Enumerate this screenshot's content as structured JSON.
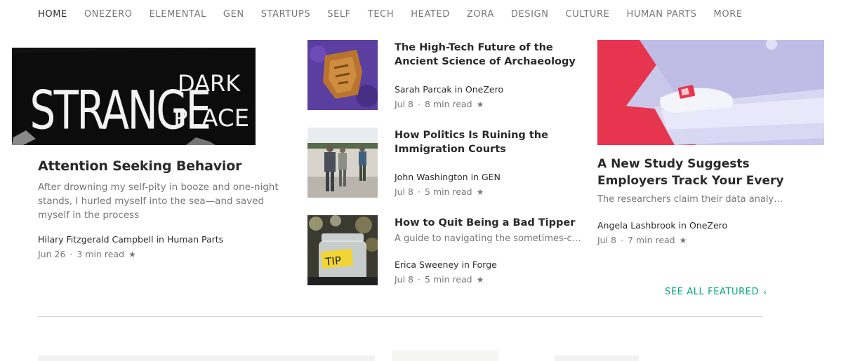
{
  "nav": {
    "items": [
      "HOME",
      "ONEZERO",
      "ELEMENTAL",
      "GEN",
      "STARTUPS",
      "SELF",
      "TECH",
      "HEATED",
      "ZORA",
      "DESIGN",
      "CULTURE",
      "HUMAN PARTS",
      "MORE"
    ],
    "active": "HOME"
  },
  "hero": {
    "image_text": [
      "STRANGE",
      "DARK",
      "PLACE"
    ],
    "title": "Attention Seeking Behavior",
    "subtitle": "After drowning my self-pity in booze and one-night stands, I hurled myself into the sea—and saved myself in the process",
    "byline": "Hilary Fitzgerald Campbell in Human Parts",
    "date": "Jun 26",
    "read_time": "3 min read"
  },
  "middle": [
    {
      "title": "The High-Tech Future of the Ancient Science of Archaeology",
      "subtitle": "",
      "byline": "Sarah Parcak in OneZero",
      "date": "Jul 8",
      "read_time": "8 min read"
    },
    {
      "title": "How Politics Is Ruining the Immigration Courts",
      "subtitle": "",
      "byline": "John Washington in GEN",
      "date": "Jul 8",
      "read_time": "5 min read"
    },
    {
      "title": "How to Quit Being a Bad Tipper",
      "subtitle": "A guide to navigating the sometimes-co…",
      "byline": "Erica Sweeney in Forge",
      "date": "Jul 8",
      "read_time": "5 min read",
      "image_text": "TIP"
    }
  ],
  "right": {
    "title": "A New Study Suggests Employers Track Your Every",
    "subtitle": "The researchers claim their data analysi…",
    "byline": "Angela Lashbrook in OneZero",
    "date": "Jul 8",
    "read_time": "7 min read"
  },
  "see_all": {
    "label": "SEE ALL FEATURED"
  },
  "colors": {
    "accent": "#03a87c",
    "text": "#292929",
    "muted": "#757575"
  }
}
